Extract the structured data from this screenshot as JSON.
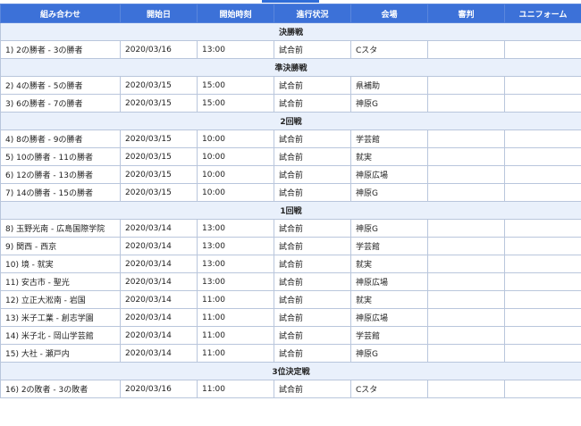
{
  "headers": {
    "match": "組み合わせ",
    "date": "開始日",
    "time": "開始時刻",
    "status": "進行状況",
    "venue": "会場",
    "referee": "審判",
    "uniform": "ユニフォーム"
  },
  "rounds": [
    {
      "name": "決勝戦",
      "matches": [
        {
          "match": "1)  2の勝者 - 3の勝者",
          "date": "2020/03/16",
          "time": "13:00",
          "status": "試合前",
          "venue": "Cスタ",
          "referee": "",
          "uniform": ""
        }
      ]
    },
    {
      "name": "準決勝戦",
      "matches": [
        {
          "match": "2)  4の勝者 - 5の勝者",
          "date": "2020/03/15",
          "time": "15:00",
          "status": "試合前",
          "venue": "県補助",
          "referee": "",
          "uniform": ""
        },
        {
          "match": "3)  6の勝者 - 7の勝者",
          "date": "2020/03/15",
          "time": "15:00",
          "status": "試合前",
          "venue": "神原G",
          "referee": "",
          "uniform": ""
        }
      ]
    },
    {
      "name": "2回戦",
      "matches": [
        {
          "match": "4)  8の勝者 - 9の勝者",
          "date": "2020/03/15",
          "time": "10:00",
          "status": "試合前",
          "venue": "学芸館",
          "referee": "",
          "uniform": ""
        },
        {
          "match": "5)  10の勝者 - 11の勝者",
          "date": "2020/03/15",
          "time": "10:00",
          "status": "試合前",
          "venue": "就実",
          "referee": "",
          "uniform": ""
        },
        {
          "match": "6)  12の勝者 - 13の勝者",
          "date": "2020/03/15",
          "time": "10:00",
          "status": "試合前",
          "venue": "神原広場",
          "referee": "",
          "uniform": ""
        },
        {
          "match": "7)  14の勝者 - 15の勝者",
          "date": "2020/03/15",
          "time": "10:00",
          "status": "試合前",
          "venue": "神原G",
          "referee": "",
          "uniform": ""
        }
      ]
    },
    {
      "name": "1回戦",
      "matches": [
        {
          "match": "8)  玉野光南 - 広島国際学院",
          "date": "2020/03/14",
          "time": "13:00",
          "status": "試合前",
          "venue": "神原G",
          "referee": "",
          "uniform": ""
        },
        {
          "match": "9)  関西 - 西京",
          "date": "2020/03/14",
          "time": "13:00",
          "status": "試合前",
          "venue": "学芸館",
          "referee": "",
          "uniform": ""
        },
        {
          "match": "10)  境 - 就実",
          "date": "2020/03/14",
          "time": "13:00",
          "status": "試合前",
          "venue": "就実",
          "referee": "",
          "uniform": ""
        },
        {
          "match": "11)  安古市 - 聖光",
          "date": "2020/03/14",
          "time": "13:00",
          "status": "試合前",
          "venue": "神原広場",
          "referee": "",
          "uniform": ""
        },
        {
          "match": "12)  立正大淞南 - 岩国",
          "date": "2020/03/14",
          "time": "11:00",
          "status": "試合前",
          "venue": "就実",
          "referee": "",
          "uniform": ""
        },
        {
          "match": "13)  米子工業 - 創志学園",
          "date": "2020/03/14",
          "time": "11:00",
          "status": "試合前",
          "venue": "神原広場",
          "referee": "",
          "uniform": ""
        },
        {
          "match": "14)  米子北 - 岡山学芸館",
          "date": "2020/03/14",
          "time": "11:00",
          "status": "試合前",
          "venue": "学芸館",
          "referee": "",
          "uniform": ""
        },
        {
          "match": "15)  大社 - 瀬戸内",
          "date": "2020/03/14",
          "time": "11:00",
          "status": "試合前",
          "venue": "神原G",
          "referee": "",
          "uniform": ""
        }
      ]
    },
    {
      "name": "3位決定戦",
      "matches": [
        {
          "match": "16)  2の敗者 - 3の敗者",
          "date": "2020/03/16",
          "time": "11:00",
          "status": "試合前",
          "venue": "Cスタ",
          "referee": "",
          "uniform": ""
        }
      ]
    }
  ]
}
